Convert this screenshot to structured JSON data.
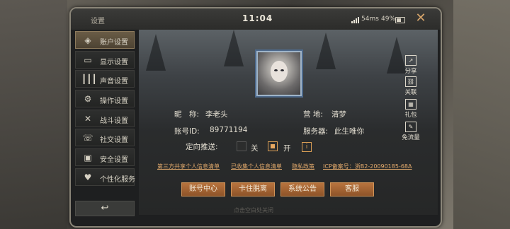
{
  "topbar": {
    "title": "设置",
    "time": "11:04",
    "ping": "54ms",
    "battery": "49%",
    "close_icon": "x-icon"
  },
  "sidebar": {
    "items": [
      {
        "label": "账户设置",
        "icon": "account-icon",
        "active": true
      },
      {
        "label": "显示设置",
        "icon": "display-icon",
        "active": false
      },
      {
        "label": "声音设置",
        "icon": "sound-icon",
        "active": false
      },
      {
        "label": "操作设置",
        "icon": "controls-icon",
        "active": false
      },
      {
        "label": "战斗设置",
        "icon": "combat-icon",
        "active": false
      },
      {
        "label": "社交设置",
        "icon": "social-icon",
        "active": false
      },
      {
        "label": "安全设置",
        "icon": "lock-icon",
        "active": false
      },
      {
        "label": "个性化服务",
        "icon": "heart-icon",
        "active": false
      }
    ],
    "back_icon": "↩"
  },
  "profile": {
    "nickname_label": "昵　称:",
    "nickname": "李老头",
    "camp_label": "营 地:",
    "camp": "清梦",
    "account_label": "账号ID:",
    "account_id": "89771194",
    "server_label": "服务器:",
    "server": "此生唯你",
    "push_label": "定向推送:",
    "push_off": "关",
    "push_on": "开",
    "info": "i"
  },
  "right_links": [
    {
      "label": "分享",
      "icon": "share-icon"
    },
    {
      "label": "关联",
      "icon": "link-icon"
    },
    {
      "label": "礼包",
      "icon": "gift-icon"
    },
    {
      "label": "免流量",
      "icon": "data-free-icon"
    }
  ],
  "links": [
    "第三方共享个人信息清单",
    "已收集个人信息清单",
    "隐私政策",
    "ICP备案号：浙B2-20090185-68A"
  ],
  "buttons": [
    "账号中心",
    "卡住脱离",
    "系统公告",
    "客服"
  ],
  "hint": "点击空白处关闭",
  "colors": {
    "accent": "#d99e55",
    "button": "#a5683a",
    "panel": "#1e1f20"
  }
}
